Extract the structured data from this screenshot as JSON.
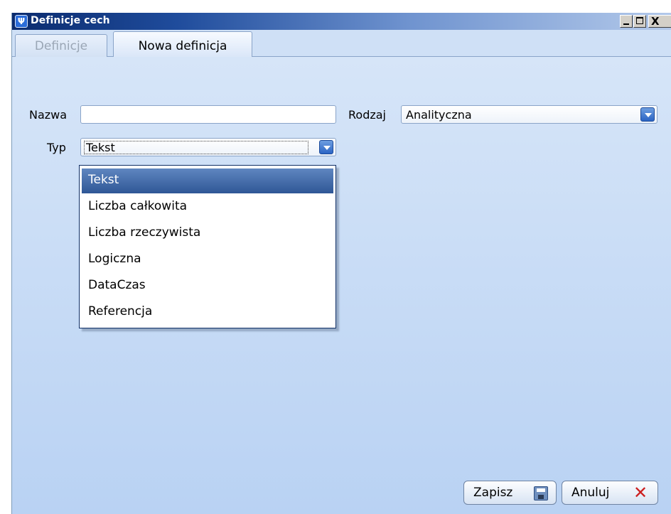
{
  "window": {
    "title": "Definicje cech",
    "app_icon": "Ψ",
    "controls": {
      "close_glyph": "X"
    }
  },
  "tabs": [
    {
      "label": "Definicje",
      "active": false
    },
    {
      "label": "Nowa definicja",
      "active": true
    }
  ],
  "form": {
    "nazwa_label": "Nazwa",
    "nazwa_value": "",
    "rodzaj_label": "Rodzaj",
    "rodzaj_value": "Analityczna",
    "typ_label": "Typ",
    "typ_value": "Tekst"
  },
  "typ_dropdown": {
    "options": [
      "Tekst",
      "Liczba całkowita",
      "Liczba rzeczywista",
      "Logiczna",
      "DataCzas",
      "Referencja"
    ],
    "selected": "Tekst"
  },
  "buttons": {
    "save_label": "Zapisz",
    "save_icon": "floppy-disk-icon",
    "cancel_label": "Anuluj",
    "cancel_icon": "red-x-icon"
  },
  "colors": {
    "titlebar_dark": "#0b2b6e",
    "panel_background": "#cfe0f6",
    "selection": "#2f5796",
    "cancel_red": "#cc1f1f"
  }
}
